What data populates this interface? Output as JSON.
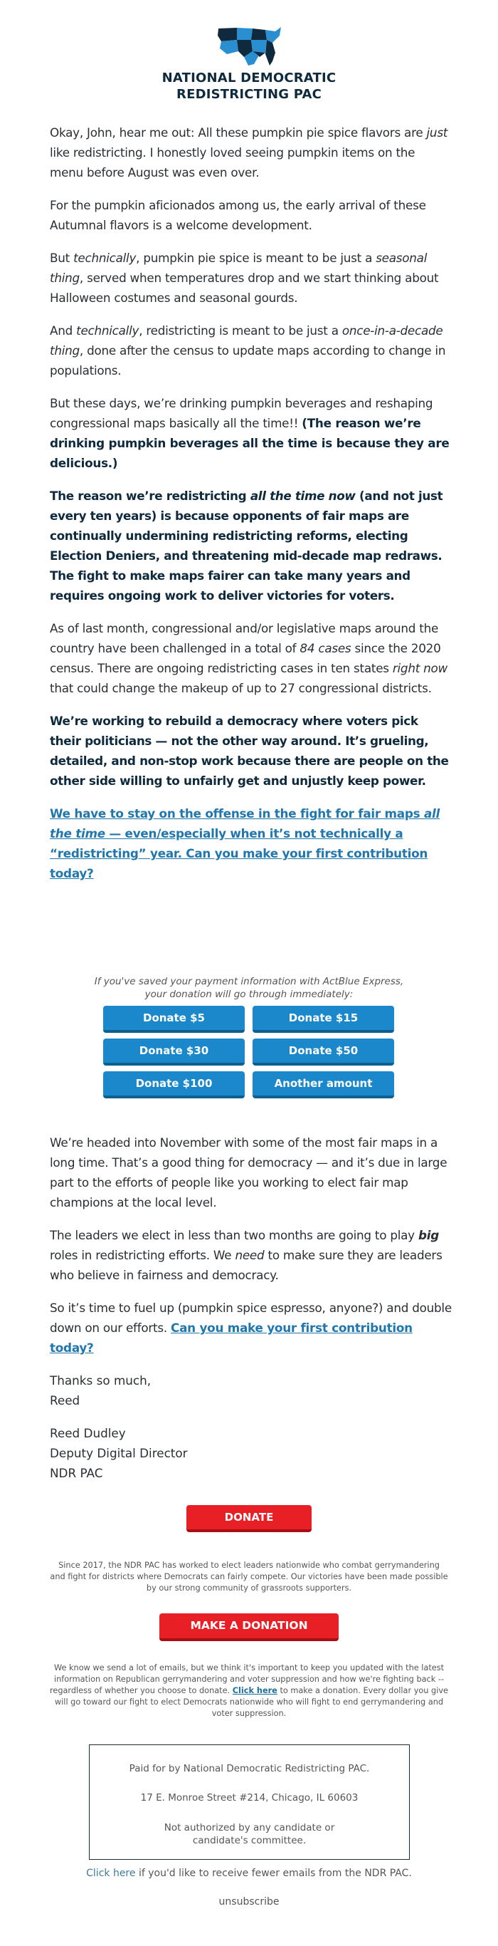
{
  "header": {
    "logo_icon": "us-map-puzzle-icon",
    "org_name_line1": "NATIONAL DEMOCRATIC",
    "org_name_line2": "REDISTRICTING PAC",
    "colors": {
      "navy": "#0f2a3d",
      "light_blue": "#2a8fd0"
    }
  },
  "body": {
    "p1": {
      "a": "Okay, John, hear me out: All these pumpkin pie spice flavors are ",
      "em": "just",
      "b": " like redistricting. I honestly loved seeing pumpkin items on the menu before August was even over."
    },
    "p2": "For the pumpkin aficionados among us, the early arrival of these Autumnal flavors is a welcome development.",
    "p3": {
      "a": "But ",
      "em1": "technically",
      "b": ", pumpkin pie spice is meant to be just a ",
      "em2": "seasonal thing",
      "c": ", served when temperatures drop and we start thinking about Halloween costumes and seasonal gourds."
    },
    "p4": {
      "a": "And ",
      "em1": "technically",
      "b": ", redistricting is meant to be just a ",
      "em2": "once-in-a-decade thing",
      "c": ", done after the census to update maps according to change in populations."
    },
    "p5": {
      "a": "But these days, we’re drinking pumpkin beverages and reshaping congressional maps basically all the time!! ",
      "strong": "(The reason we’re drinking pumpkin beverages all the time is because they are delicious.)"
    },
    "p6": {
      "a": "The reason we’re redistricting ",
      "em": "all the time now",
      "b": " (and not just every ten years) is because opponents of fair maps are continually undermining redistricting reforms, electing Election Deniers, and threatening mid-decade map redraws. The fight to make maps fairer can take many years and requires ongoing work to deliver victories for voters."
    },
    "p7": {
      "a": "As of last month, congressional and/or legislative maps around the country have been challenged in a total of ",
      "em1": "84 cases",
      "b": " since the 2020 census. There are ongoing redistricting cases in ten states ",
      "em2": "right now",
      "c": " that could change the makeup of up to 27 congressional districts."
    },
    "p8": "We’re working to rebuild a democracy where voters pick their politicians — not the other way around. It’s grueling, detailed, and non-stop work because there are people on the other side willing to unfairly get and unjustly keep power.",
    "p9_link": {
      "a": "We have to stay on the offense in the fight for fair maps ",
      "em": "all the time",
      "b": " — even/especially when it’s not technically a “redistricting” year. Can you make your first contribution today?"
    }
  },
  "donate": {
    "note": "If you've saved your payment information with ActBlue Express, your donation will go through immediately:",
    "buttons": [
      "Donate $5",
      "Donate $15",
      "Donate $30",
      "Donate $50",
      "Donate $100",
      "Another amount"
    ],
    "button_color": "#1a88cb"
  },
  "body2": {
    "p10": "We’re headed into November with some of the most fair maps in a long time. That’s a good thing for democracy — and it’s due in large part to the efforts of people like you working to elect fair map champions at the local level.",
    "p11": {
      "a": "The leaders we elect in less than two months are going to play ",
      "strong_em": "big",
      "b": " roles in redistricting efforts. We ",
      "em": "need",
      "c": " to make sure they are leaders who believe in fairness and democracy."
    },
    "p12": {
      "a": "So it’s time to fuel up (pumpkin spice espresso, anyone?) and double down on our efforts. ",
      "link": "Can you make your first contribution today?"
    },
    "closing": [
      "Thanks so much,",
      "Reed"
    ],
    "signature": [
      "Reed Dudley",
      "Deputy Digital Director",
      "NDR PAC"
    ]
  },
  "footer": {
    "donate_button": "DONATE",
    "about": "Since 2017, the NDR PAC has worked to elect leaders nationwide who combat gerrymandering and fight for districts where Democrats can fairly compete. Our victories have been made possible by our strong community of grassroots supporters.",
    "make_donation_button": "MAKE A DONATION",
    "emails_note": {
      "a": "We know we send a lot of emails, but we think it's important to keep you updated with the latest information on Republican gerrymandering and voter suppression and how we're fighting back -- regardless of whether you choose to donate. ",
      "link": "Click here",
      "b": " to make a donation. Every dollar you give will go toward our fight to elect Democrats nationwide who will fight to end gerrymandering and voter suppression."
    },
    "disclaimer": [
      "Paid for by National Democratic Redistricting PAC.",
      "17 E. Monroe Street #214, Chicago, IL 60603",
      "Not authorized by any candidate or candidate's committee."
    ],
    "fewer_link": "Click here",
    "fewer_text": " if you'd like to receive fewer emails from the NDR PAC.",
    "unsubscribe": "unsubscribe",
    "red_button_color": "#e81f25"
  }
}
